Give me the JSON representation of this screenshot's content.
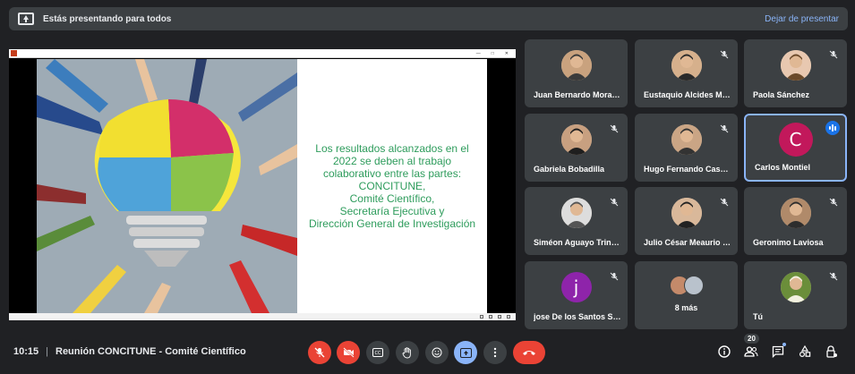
{
  "banner": {
    "text": "Estás presentando para todos",
    "stop_label": "Dejar de presentar"
  },
  "slide": {
    "lines": [
      "Los resultados alcanzados en el",
      "2022 se deben al trabajo",
      "colaborativo entre las partes:",
      "CONCITUNE,",
      "Comité Científico,",
      "Secretaría Ejecutiva y",
      "Dirección General de Investigación"
    ],
    "text_color": "#2e9c5c"
  },
  "participants": [
    {
      "name": "Juan Bernardo Moral…",
      "avatar": "photo",
      "muted": false
    },
    {
      "name": "Eustaquio Alcides M…",
      "avatar": "photo",
      "muted": true
    },
    {
      "name": "Paola Sánchez",
      "avatar": "photo",
      "muted": true
    },
    {
      "name": "Gabriela Bobadilla",
      "avatar": "photo",
      "muted": true
    },
    {
      "name": "Hugo Fernando Casa…",
      "avatar": "photo",
      "muted": true
    },
    {
      "name": "Carlos Montiel",
      "avatar": "letter",
      "letter": "C",
      "color": "#c2185b",
      "speaking": true
    },
    {
      "name": "Siméon Aguayo Trini…",
      "avatar": "photo",
      "muted": true
    },
    {
      "name": "Julio César Meaurio …",
      "avatar": "photo",
      "muted": true
    },
    {
      "name": "Geronimo Laviosa",
      "avatar": "photo",
      "muted": true
    },
    {
      "name": "jose De los Santos Sa…",
      "avatar": "letter",
      "letter": "j",
      "color": "#8e24aa",
      "muted": true
    },
    {
      "name": "8 más",
      "avatar": "group"
    },
    {
      "name": "Tú",
      "avatar": "photo",
      "muted": true
    }
  ],
  "bottombar": {
    "time": "10:15",
    "separator": "|",
    "meeting_name": "Reunión CONCITUNE - Comité Científico",
    "participant_count": "20"
  },
  "colors": {
    "accent": "#8ab4f8",
    "danger": "#ea4335",
    "tile": "#3c4043",
    "background": "#202124"
  }
}
